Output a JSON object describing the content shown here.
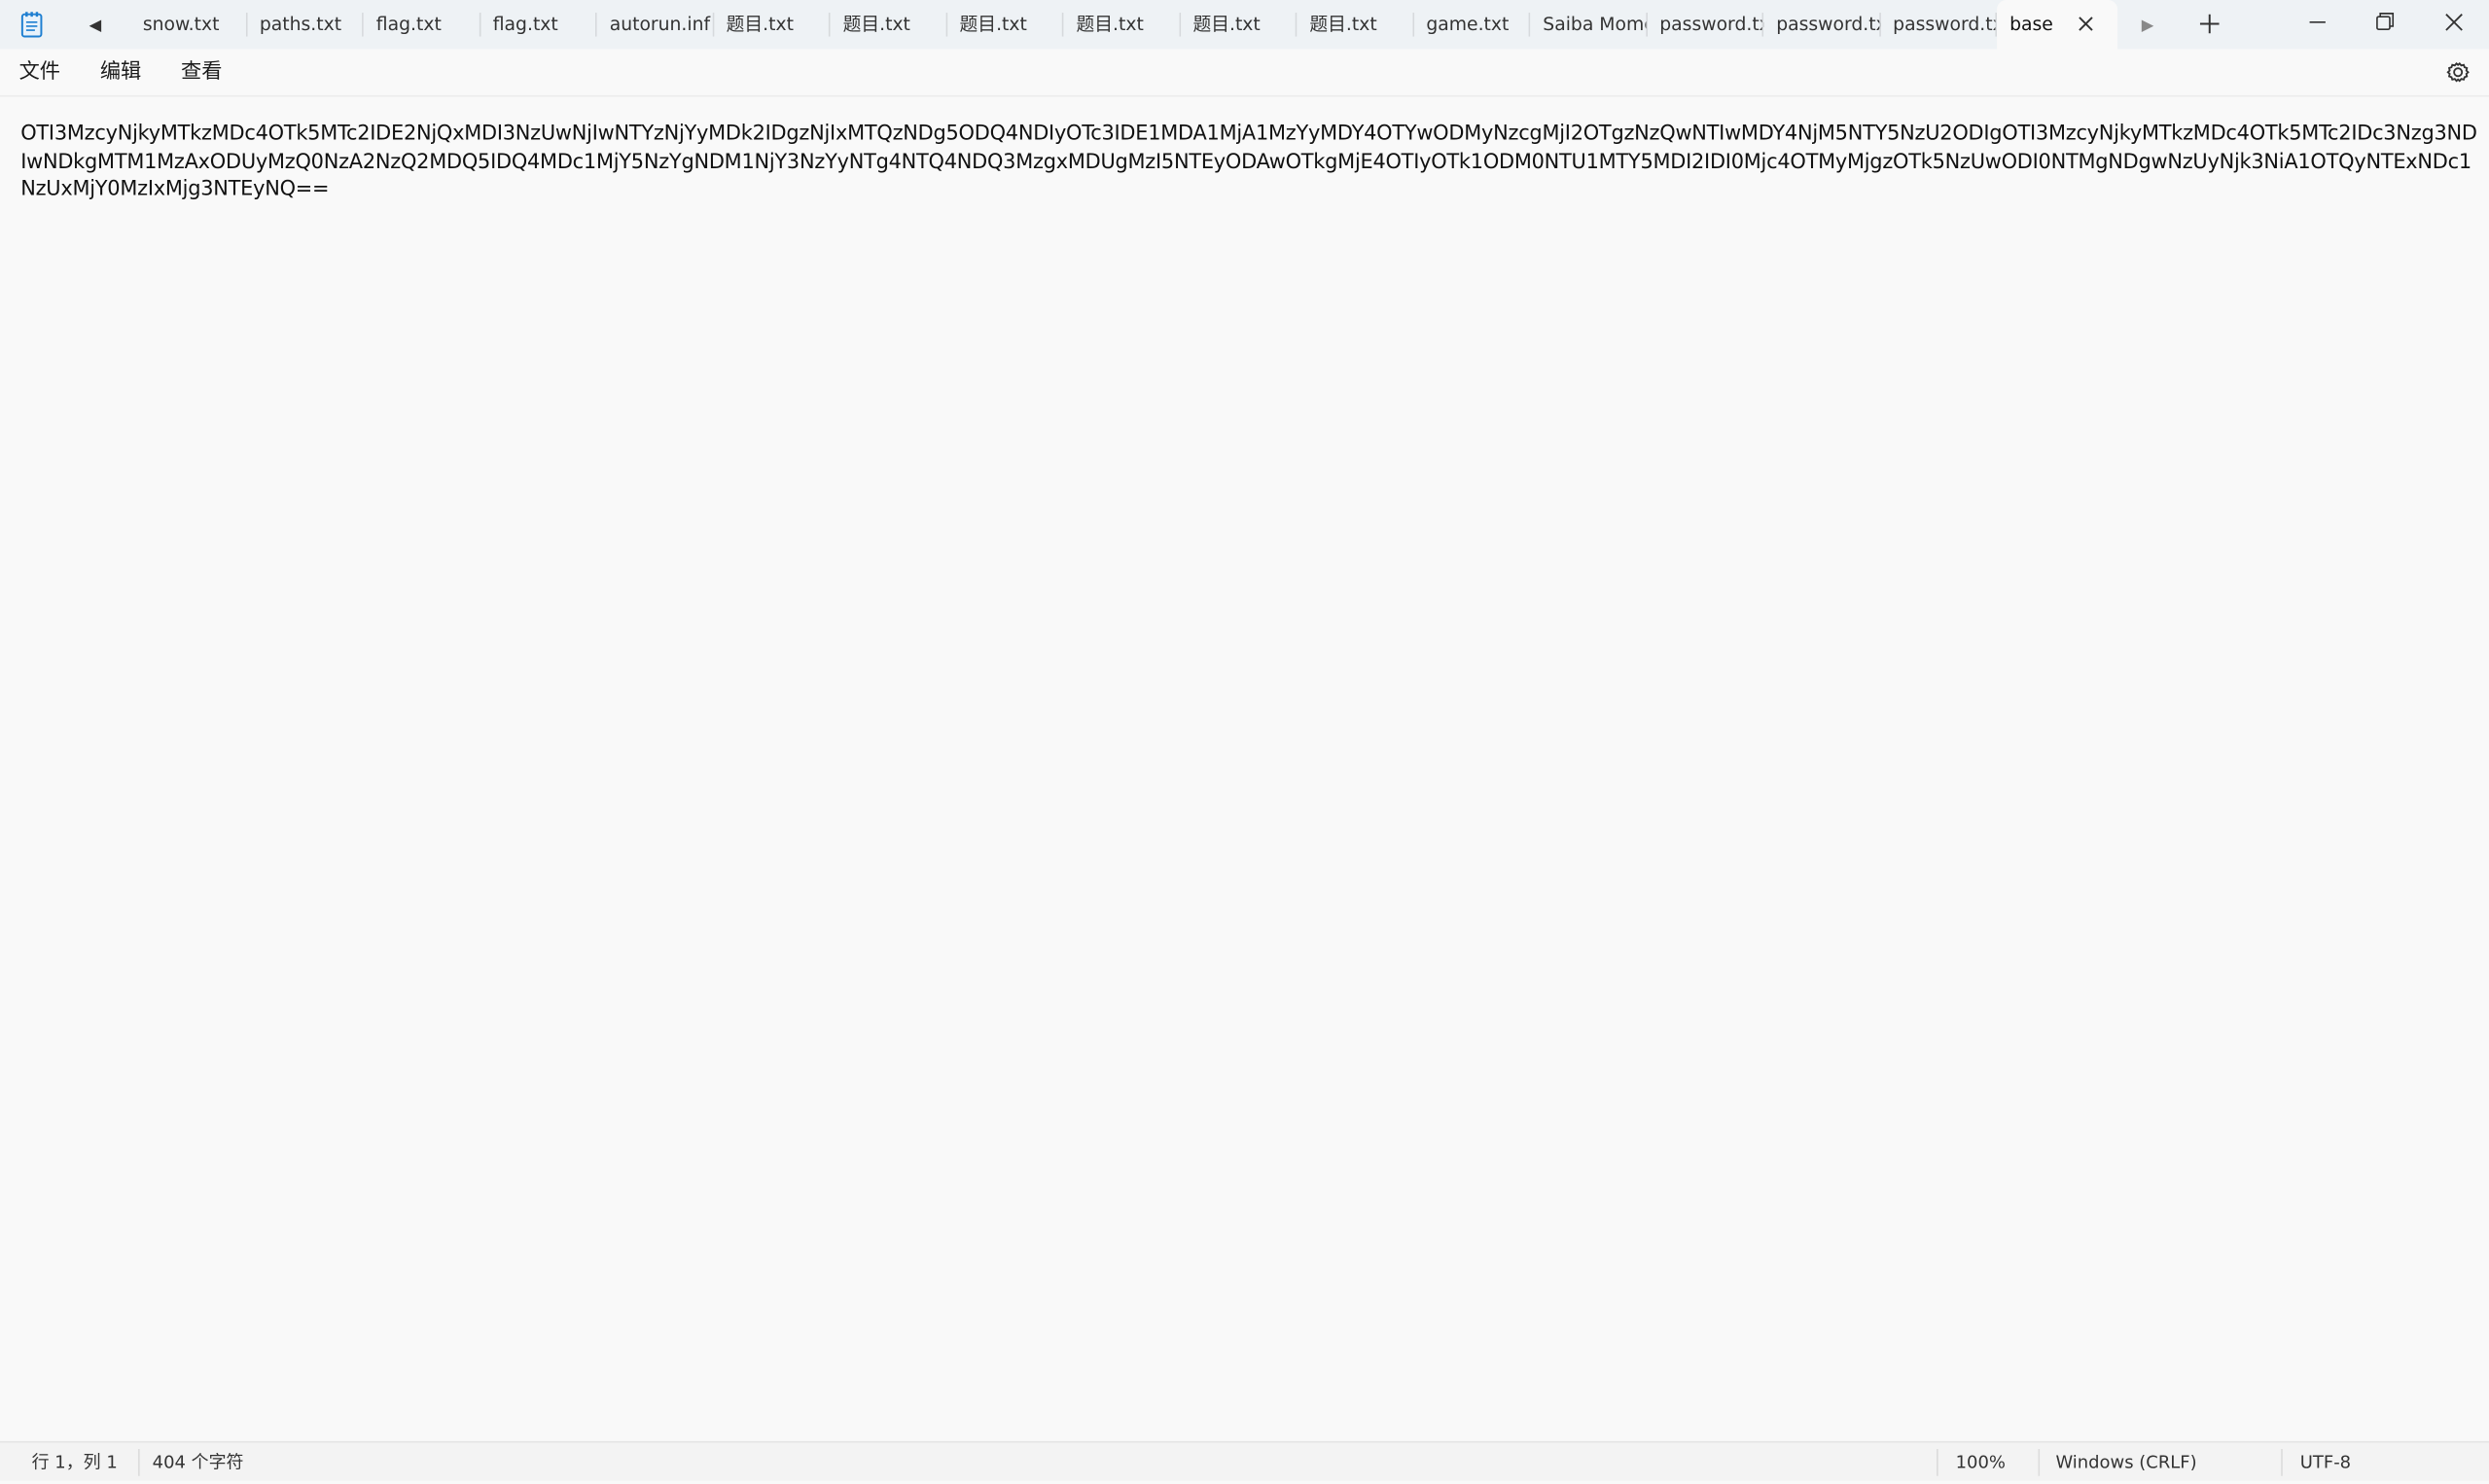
{
  "titlebar": {
    "tabs": [
      {
        "label": "snow.txt"
      },
      {
        "label": "paths.txt"
      },
      {
        "label": "flag.txt"
      },
      {
        "label": "flag.txt"
      },
      {
        "label": "autorun.inf"
      },
      {
        "label": "题目.txt"
      },
      {
        "label": "题目.txt"
      },
      {
        "label": "题目.txt"
      },
      {
        "label": "题目.txt"
      },
      {
        "label": "题目.txt"
      },
      {
        "label": "题目.txt"
      },
      {
        "label": "game.txt"
      },
      {
        "label": "Saiba Momo"
      },
      {
        "label": "password.txt"
      },
      {
        "label": "password.txt"
      },
      {
        "label": "password.txt"
      }
    ],
    "active_tab": {
      "label": "base"
    },
    "icons": {
      "app": "notepad-icon",
      "scroll_left": "caret-left-icon",
      "scroll_right": "caret-right-icon",
      "close_tab": "close-icon",
      "new_tab": "plus-icon",
      "minimize": "minimize-icon",
      "maximize": "restore-icon",
      "close_window": "close-icon"
    }
  },
  "menubar": {
    "file": "文件",
    "edit": "编辑",
    "view": "查看",
    "settings_icon": "gear-icon"
  },
  "editor": {
    "content": "OTI3MzcyNjkyMTkzMDc4OTk5MTc2IDE2NjQxMDI3NzUwNjIwNTYzNjYyMDk2IDgzNjIxMTQzNDg5ODQ4NDIyOTc3IDE1MDA1MjA1MzYyMDY4OTYwODMyNzcgMjI2OTgzNzQwNTIwMDY4NjM5NTY5NzU2ODIgOTI3MzcyNjkyMTkzMDc4OTk5MTc2IDc3Nzg3NDIwNDkgMTM1MzAxODUyMzQ0NzA2NzQ2MDQ5IDQ4MDc1MjY5NzYgNDM1NjY3NzYyNTg4NTQ4NDQ3MzgxMDUgMzI5NTEyODAwOTkgMjE4OTIyOTk1ODM0NTU1MTY5MDI2IDI0Mjc4OTMyMjgzOTk5NzUwODI0NTMgNDgwNzUyNjk3NiA1OTQyNTExNDc1NzUxMjY0MzIxMjg3NTEyNQ=="
  },
  "statusbar": {
    "position": "行 1，列 1",
    "char_count": "404 个字符",
    "zoom": "100%",
    "line_ending": "Windows (CRLF)",
    "encoding": "UTF-8"
  },
  "colors": {
    "titlebar_bg": "#eef2f5",
    "editor_bg": "#f9f9f9",
    "statusbar_bg": "#f3f3f3",
    "icon_accent": "#1e7fd1"
  }
}
